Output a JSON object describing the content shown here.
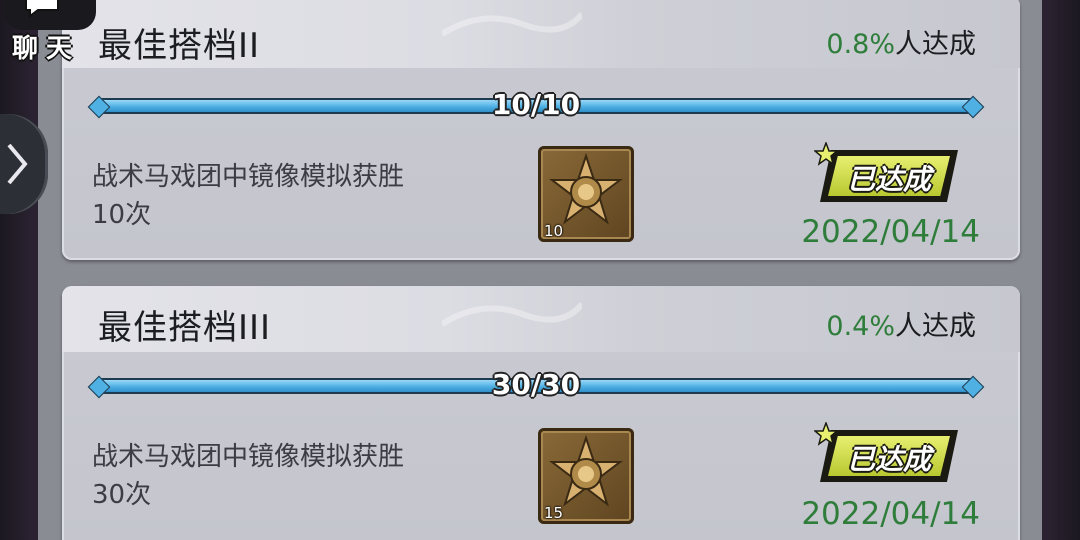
{
  "chat": {
    "label": "聊天"
  },
  "achievements": [
    {
      "title": "最佳搭档II",
      "percent": "0.8%",
      "percent_suffix": "人达成",
      "progress_text": "10/10",
      "progress": 1.0,
      "description_line1": "战术马戏团中镜像模拟获胜",
      "description_line2": "10次",
      "medal_count": "10",
      "status": "已达成",
      "date": "2022/04/14"
    },
    {
      "title": "最佳搭档III",
      "percent": "0.4%",
      "percent_suffix": "人达成",
      "progress_text": "30/30",
      "progress": 1.0,
      "description_line1": "战术马戏团中镜像模拟获胜",
      "description_line2": "30次",
      "medal_count": "15",
      "status": "已达成",
      "date": "2022/04/14"
    }
  ],
  "colors": {
    "accent_green": "#2f7d3a",
    "progress_blue": "#4fb0e4",
    "badge_yellow": "#d8e050"
  },
  "icons": {
    "chat": "chat-bubble-icon",
    "side": "chevron-right-icon",
    "medal": "star-medal-icon",
    "badge_star": "star-icon"
  }
}
